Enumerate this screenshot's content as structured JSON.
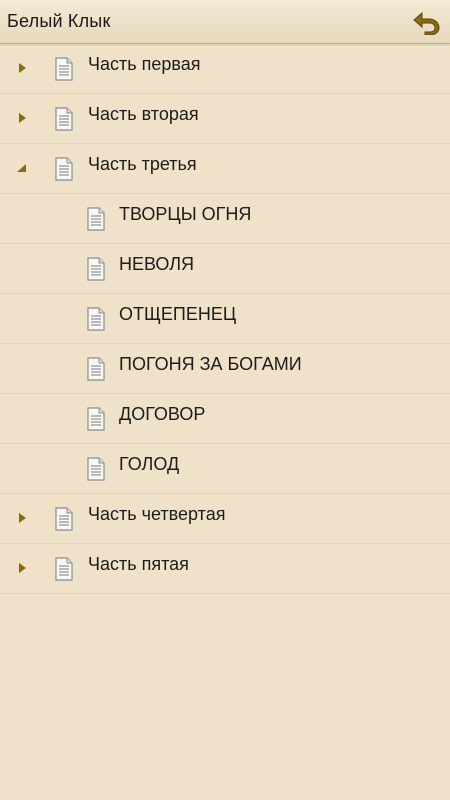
{
  "header": {
    "title": "Белый Клык",
    "back_icon": "back-arrow-icon"
  },
  "colors": {
    "background": "#efe2c9",
    "accent": "#8a6a12"
  },
  "tree": [
    {
      "label": "Часть первая",
      "level": 0,
      "expand_state": "collapsed"
    },
    {
      "label": "Часть вторая",
      "level": 0,
      "expand_state": "collapsed"
    },
    {
      "label": "Часть третья",
      "level": 0,
      "expand_state": "expanded"
    },
    {
      "label": "ТВОРЦЫ ОГНЯ",
      "level": 1,
      "expand_state": "none"
    },
    {
      "label": "НЕВОЛЯ",
      "level": 1,
      "expand_state": "none"
    },
    {
      "label": "ОТЩЕПЕНЕЦ",
      "level": 1,
      "expand_state": "none"
    },
    {
      "label": "ПОГОНЯ ЗА БОГАМИ",
      "level": 1,
      "expand_state": "none"
    },
    {
      "label": "ДОГОВОР",
      "level": 1,
      "expand_state": "none"
    },
    {
      "label": "ГОЛОД",
      "level": 1,
      "expand_state": "none"
    },
    {
      "label": "Часть четвертая",
      "level": 0,
      "expand_state": "collapsed"
    },
    {
      "label": "Часть пятая",
      "level": 0,
      "expand_state": "collapsed"
    }
  ]
}
